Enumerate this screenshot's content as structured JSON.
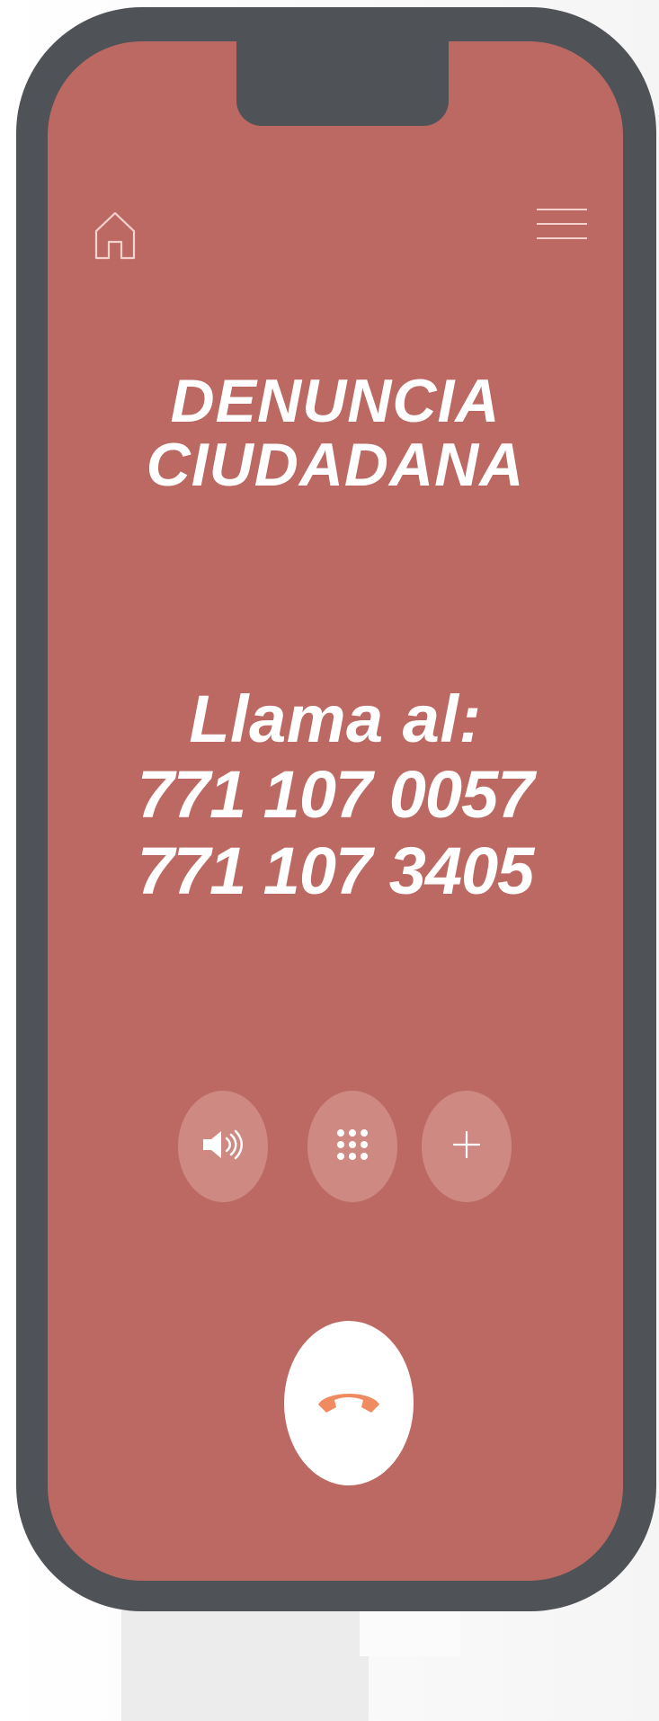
{
  "screen": {
    "headline": {
      "line1": "DENUNCIA",
      "line2": "CIUDADANA"
    },
    "call": {
      "label": "Llama al:",
      "numbers": [
        "771 107 0057",
        "771 107 3405"
      ]
    },
    "icons": {
      "home": "home-icon",
      "menu": "menu-icon",
      "speaker": "speaker-icon",
      "keypad": "keypad-icon",
      "add": "plus-icon",
      "end_call": "end-call-icon"
    },
    "colors": {
      "background": "#bd6963",
      "phone_frame": "#4f5256",
      "control_button": "#cf8983",
      "end_call_button": "#ffffff",
      "end_call_icon": "#ef8a61"
    }
  }
}
